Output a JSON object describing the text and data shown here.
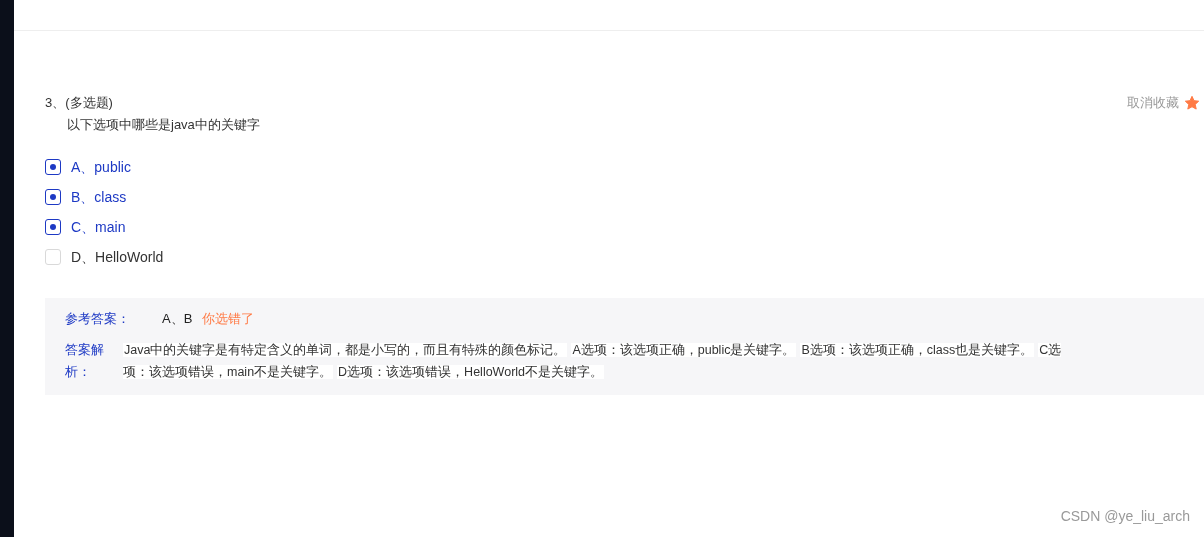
{
  "question": {
    "number": "3、",
    "type": "(多选题)",
    "text": "以下选项中哪些是java中的关键字",
    "favorite": {
      "label": "取消收藏",
      "on": true
    }
  },
  "options": [
    {
      "label": "A、public",
      "checked": true
    },
    {
      "label": "B、class",
      "checked": true
    },
    {
      "label": "C、main",
      "checked": true
    },
    {
      "label": "D、HelloWorld",
      "checked": false
    }
  ],
  "answer": {
    "label": "参考答案：",
    "value": "A、B",
    "verdict": "你选错了"
  },
  "analysis": {
    "label": "答案解析：",
    "segments": [
      "Java中的关键字是有特定含义的单词，都是小写的，而且有特殊的颜色标记。",
      "A选项：该选项正确，public是关键字。",
      "B选项：该选项正确，class也是关键字。",
      "C选项：该选项错误，main不是关键字。",
      "D选项：该选项错误，HelloWorld不是关键字。"
    ]
  },
  "watermark": "CSDN @ye_liu_arch"
}
